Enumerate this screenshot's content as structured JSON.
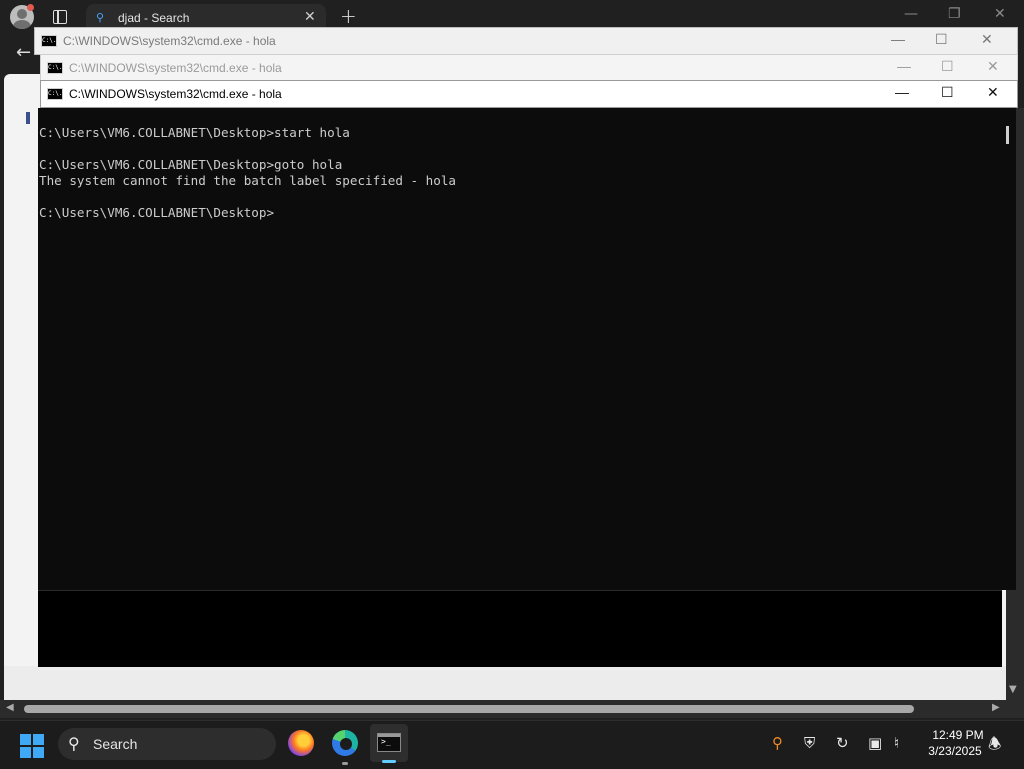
{
  "browser": {
    "tab_title": "djad - Search"
  },
  "windows": [
    {
      "title": "C:\\WINDOWS\\system32\\cmd.exe - hola"
    },
    {
      "title": "C:\\WINDOWS\\system32\\cmd.exe - hola"
    },
    {
      "title": "C:\\WINDOWS\\system32\\cmd.exe - hola"
    }
  ],
  "console": {
    "lines": [
      "C:\\Users\\VM6.COLLABNET\\Desktop>start hola",
      "",
      "C:\\Users\\VM6.COLLABNET\\Desktop>goto hola",
      "The system cannot find the batch label specified - hola",
      "",
      "C:\\Users\\VM6.COLLABNET\\Desktop>"
    ]
  },
  "taskbar": {
    "search_label": "Search",
    "time": "12:49 PM",
    "date": "3/23/2025",
    "accent_color": "#3fa9f5"
  },
  "icons": {
    "cmd_icon_text": "C:\\."
  }
}
